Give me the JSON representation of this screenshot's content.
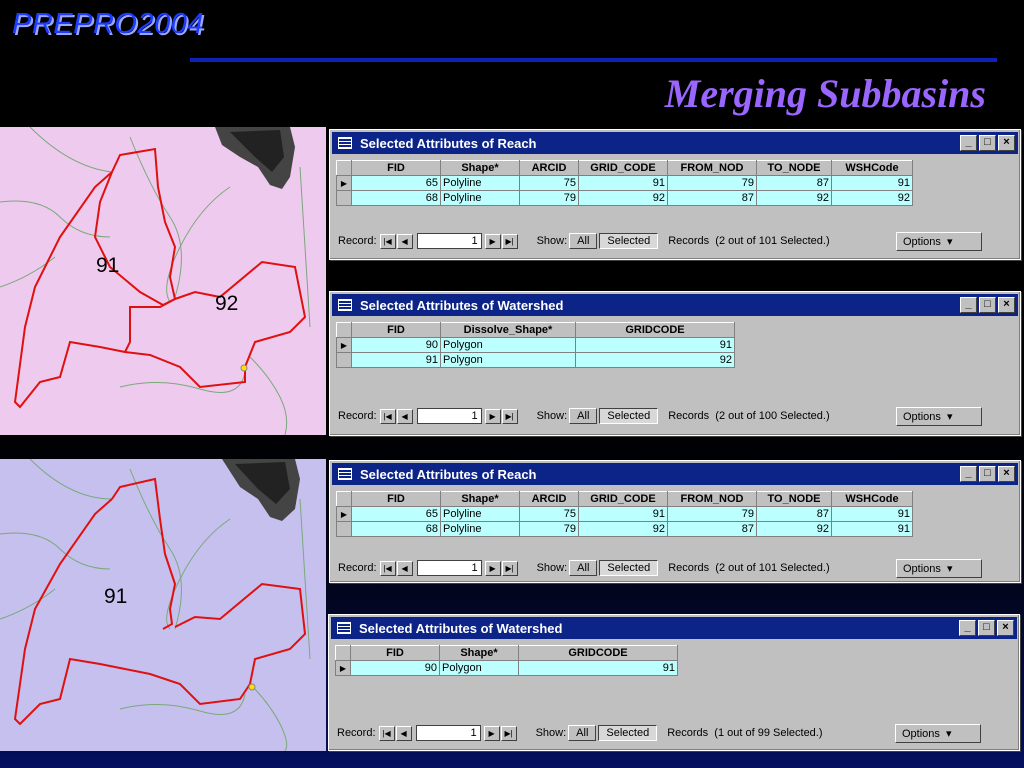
{
  "header": {
    "brand": "PREPRO2004",
    "title": "Merging Subbasins"
  },
  "maps": [
    {
      "labels": [
        "91",
        "92"
      ]
    },
    {
      "labels": [
        "91"
      ]
    }
  ],
  "windows": [
    {
      "title": "Selected Attributes of Reach",
      "columns": [
        "FID",
        "Shape*",
        "ARCID",
        "GRID_CODE",
        "FROM_NOD",
        "TO_NODE",
        "WSHCode"
      ],
      "rows": [
        [
          "65",
          "Polyline",
          "75",
          "91",
          "79",
          "87",
          "91"
        ],
        [
          "68",
          "Polyline",
          "79",
          "92",
          "87",
          "92",
          "92"
        ]
      ],
      "record_label": "Record:",
      "record_value": "1",
      "show_label": "Show:",
      "all_label": "All",
      "selected_label": "Selected",
      "status": "Records  (2 out of 101 Selected.)",
      "options_label": "Options"
    },
    {
      "title": "Selected Attributes of Watershed",
      "columns": [
        "FID",
        "Dissolve_Shape*",
        "GRIDCODE"
      ],
      "rows": [
        [
          "90",
          "Polygon",
          "91"
        ],
        [
          "91",
          "Polygon",
          "92"
        ]
      ],
      "record_label": "Record:",
      "record_value": "1",
      "show_label": "Show:",
      "all_label": "All",
      "selected_label": "Selected",
      "status": "Records  (2 out of 100 Selected.)",
      "options_label": "Options"
    },
    {
      "title": "Selected Attributes of Reach",
      "columns": [
        "FID",
        "Shape*",
        "ARCID",
        "GRID_CODE",
        "FROM_NOD",
        "TO_NODE",
        "WSHCode"
      ],
      "rows": [
        [
          "65",
          "Polyline",
          "75",
          "91",
          "79",
          "87",
          "91"
        ],
        [
          "68",
          "Polyline",
          "79",
          "92",
          "87",
          "92",
          "91"
        ]
      ],
      "record_label": "Record:",
      "record_value": "1",
      "show_label": "Show:",
      "all_label": "All",
      "selected_label": "Selected",
      "status": "Records  (2 out of 101 Selected.)",
      "options_label": "Options"
    },
    {
      "title": "Selected Attributes of Watershed",
      "columns": [
        "FID",
        "Shape*",
        "GRIDCODE"
      ],
      "rows": [
        [
          "90",
          "Polygon",
          "91"
        ]
      ],
      "record_label": "Record:",
      "record_value": "1",
      "show_label": "Show:",
      "all_label": "All",
      "selected_label": "Selected",
      "status": "Records  (1 out of 99 Selected.)",
      "options_label": "Options"
    }
  ]
}
